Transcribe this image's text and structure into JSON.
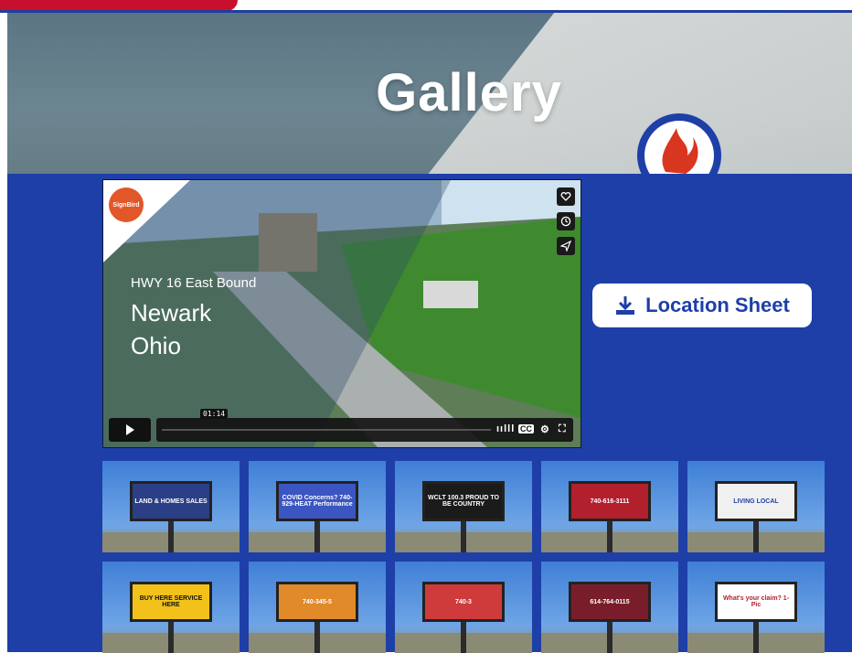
{
  "hero": {
    "title": "Gallery"
  },
  "video": {
    "brand": "SignBird",
    "subtitle": "HWY 16 East Bound",
    "city": "Newark",
    "state": "Ohio",
    "time": "01:14",
    "icons": [
      "heart-icon",
      "clock-icon",
      "send-icon",
      "play-icon",
      "volume-icon",
      "cc-icon",
      "gear-icon",
      "fullscreen-icon"
    ]
  },
  "location_sheet": {
    "label": "Location Sheet",
    "icon": "download-icon"
  },
  "gallery": {
    "thumbs": [
      {
        "text": "LAND & HOMES SALES"
      },
      {
        "text": "COVID Concerns? 740-929-HEAT Performance"
      },
      {
        "text": "WCLT 100.3 PROUD TO BE COUNTRY"
      },
      {
        "text": "740-616-3111"
      },
      {
        "text": "LIVING LOCAL"
      },
      {
        "text": "BUY HERE SERVICE HERE"
      },
      {
        "text": "740-345-5"
      },
      {
        "text": "740-3"
      },
      {
        "text": "614-764-0115"
      },
      {
        "text": "What's your claim? 1-Pic"
      }
    ]
  },
  "colors": {
    "brand_blue": "#1e3fa8",
    "brand_red": "#c8102e",
    "white": "#ffffff"
  }
}
